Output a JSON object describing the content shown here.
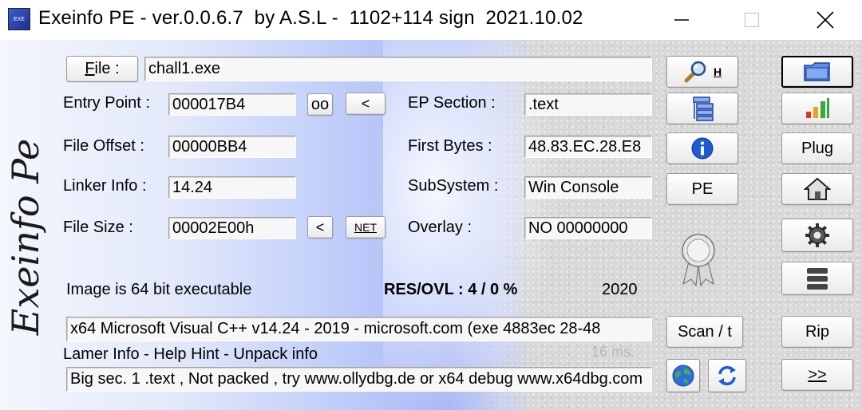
{
  "window": {
    "title": "Exeinfo PE - ver.0.0.6.7  by A.S.L -  1102+114 sign  2021.10.02",
    "app_icon_text": "EXE"
  },
  "logo": {
    "text": "Exeinfo Pe"
  },
  "file": {
    "button_label": "File :",
    "button_hotkey": "F",
    "button_rest": "ile :",
    "path": "chall1.exe"
  },
  "fields": {
    "entry_point": {
      "label": "Entry Point :",
      "value": "000017B4"
    },
    "file_offset": {
      "label": "File Offset :",
      "value": "00000BB4"
    },
    "linker_info": {
      "label": "Linker Info :",
      "value": "14.24"
    },
    "file_size": {
      "label": "File Size :",
      "value": "00002E00h"
    },
    "ep_section": {
      "label": "EP Section :",
      "value": ".text"
    },
    "first_bytes": {
      "label": "First Bytes :",
      "value": "48.83.EC.28.E8"
    },
    "subsystem": {
      "label": "SubSystem :",
      "value": "Win Console"
    },
    "overlay": {
      "label": "Overlay :",
      "value": "NO   00000000"
    }
  },
  "small_buttons": {
    "oo": "oo",
    "lt1": "<",
    "lt2": "<",
    "net": "NET"
  },
  "info": {
    "image_bits": "Image is 64 bit executable",
    "res_ovl": "RES/OVL : 4 / 0 %",
    "year": "2020",
    "detection": " x64 Microsoft Visual C++ v14.24 - 2019 - microsoft.com (exe 4883ec 28-48",
    "lamer_info": "Lamer Info - Help Hint - Unpack info",
    "scan_time": "16 ms.",
    "hint": "Big sec. 1 .text , Not packed , try  www.ollydbg.de or x64 debug www.x64dbg.com"
  },
  "middle_buttons": {
    "search_h": "H",
    "pe": "PE",
    "scan": "Scan / t"
  },
  "right_buttons": {
    "plug": "Plug",
    "rip": "Rip",
    "next": ">>"
  },
  "colors": {
    "icon_blue": "#1e5bd6",
    "bar_red": "#d93a2b",
    "bar_orange": "#f0a020",
    "bar_green": "#3aa83a"
  }
}
